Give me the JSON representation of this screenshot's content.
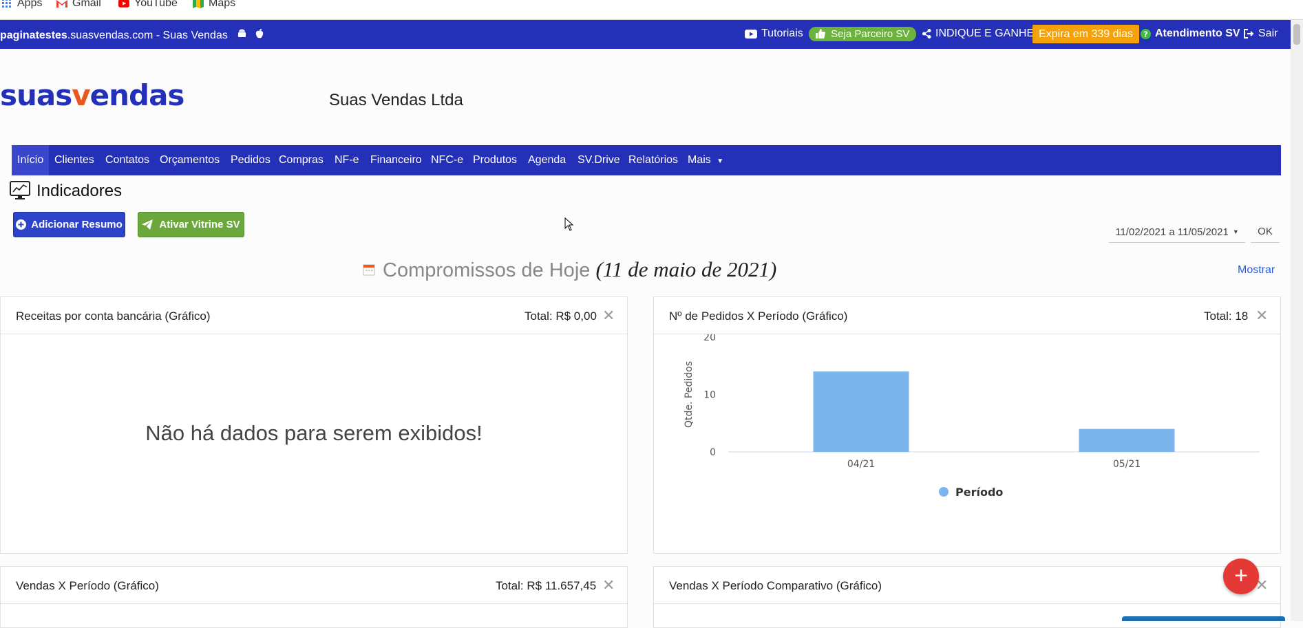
{
  "bookmarks": [
    {
      "label": "Apps",
      "icon": "apps-grid-icon"
    },
    {
      "label": "Gmail",
      "icon": "gmail-icon"
    },
    {
      "label": "YouTube",
      "icon": "youtube-icon"
    },
    {
      "label": "Maps",
      "icon": "maps-icon"
    }
  ],
  "topbar": {
    "site_bold": "paginatestes",
    "site_rest": ".suasvendas.com - Suas Vendas",
    "tutoriais": "Tutoriais",
    "parceiro": "Seja Parceiro SV",
    "indique": "INDIQUE E GANHE",
    "expira": "Expira em 339 dias",
    "atendimento": "Atendimento SV",
    "sair": "Sair"
  },
  "header": {
    "logo_part1": "suas",
    "logo_part2": "v",
    "logo_part3": "endas",
    "company": "Suas Vendas Ltda"
  },
  "nav": [
    "Início",
    "Clientes",
    "Contatos",
    "Orçamentos",
    "Pedidos",
    "Compras",
    "NF-e",
    "Financeiro",
    "NFC-e",
    "Produtos",
    "Agenda",
    "SV.Drive",
    "Relatórios",
    "Mais"
  ],
  "page": {
    "title": "Indicadores",
    "add_resumo": "Adicionar Resumo",
    "ativar_vitrine": "Ativar Vitrine SV",
    "date_range": "11/02/2021 a 11/05/2021",
    "ok": "OK",
    "compromissos_label": "Compromissos de Hoje",
    "compromissos_date": "(11 de maio de 2021)",
    "mostrar": "Mostrar"
  },
  "cards": {
    "receitas": {
      "title": "Receitas por conta bancária (Gráfico)",
      "total": "Total: R$ 0,00",
      "empty": "Não há dados para serem exibidos!"
    },
    "pedidos": {
      "title": "Nº de Pedidos X Período (Gráfico)",
      "total": "Total: 18"
    },
    "vendas": {
      "title": "Vendas X Período (Gráfico)",
      "total": "Total: R$ 11.657,45"
    },
    "vendas_comp": {
      "title": "Vendas X Período Comparativo (Gráfico)"
    }
  },
  "chart_data": {
    "type": "bar",
    "categories": [
      "04/21",
      "05/21"
    ],
    "series": [
      {
        "name": "Período",
        "values": [
          14,
          4
        ]
      }
    ],
    "ylabel": "Qtde. Pedidos",
    "yticks": [
      "0",
      "10",
      "20"
    ],
    "ylim": [
      0,
      20
    ],
    "color": "#7cb5ec"
  },
  "colors": {
    "brand": "#2530b8",
    "accent": "#e8571d",
    "success": "#6aa83b",
    "warning": "#f5a10a",
    "danger": "#e53935"
  }
}
